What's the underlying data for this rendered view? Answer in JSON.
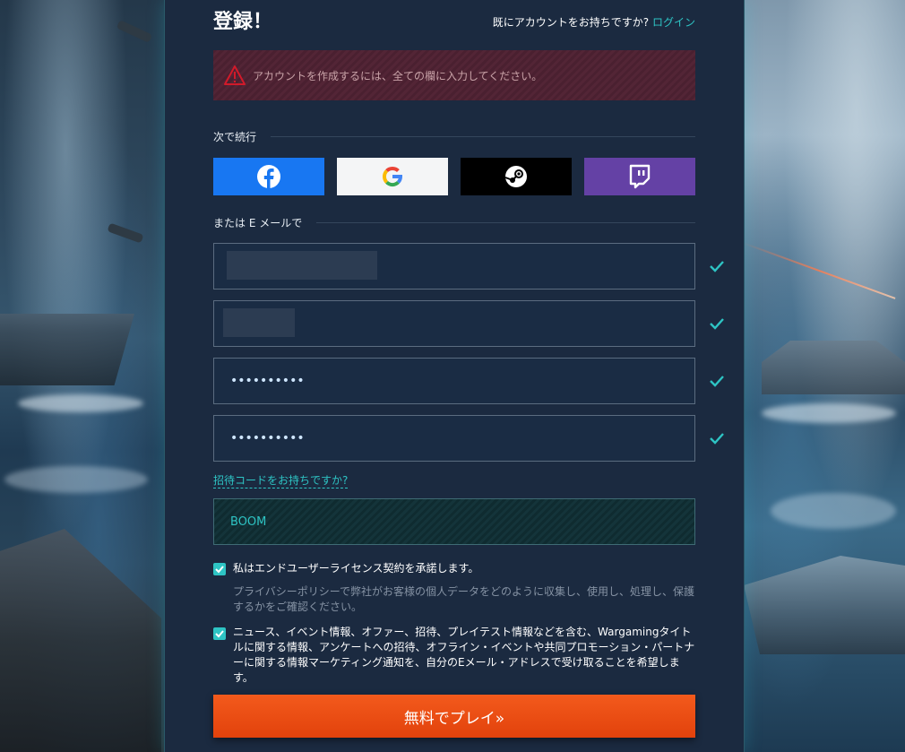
{
  "header": {
    "title": "登録！",
    "login_prompt": "既にアカウントをお持ちですか?",
    "login_link": "ログイン"
  },
  "error": {
    "icon": "warning-icon",
    "message": "アカウントを作成するには、全ての欄に入力してください。"
  },
  "social": {
    "section_label": "次で続行",
    "buttons": [
      {
        "name": "facebook",
        "icon": "facebook-icon",
        "color": "#1877f2"
      },
      {
        "name": "google",
        "icon": "google-icon",
        "color": "#f4f5f6"
      },
      {
        "name": "steam",
        "icon": "steam-icon",
        "color": "#000000"
      },
      {
        "name": "twitch",
        "icon": "twitch-icon",
        "color": "#6441a5"
      }
    ]
  },
  "email_section": {
    "label": "または E メールで",
    "fields": [
      {
        "name": "email",
        "value": "",
        "valid": true
      },
      {
        "name": "username",
        "value": "",
        "valid": true
      },
      {
        "name": "password",
        "value": "••••••••••",
        "valid": true
      },
      {
        "name": "password-confirm",
        "value": "••••••••••",
        "valid": true
      }
    ]
  },
  "invite": {
    "link_text": "招待コードをお持ちですか?",
    "code_value": "BOOM"
  },
  "consents": {
    "eula_checked": true,
    "eula_text": "私はエンドユーザーライセンス契約を承諾します。",
    "privacy_text": "プライバシーポリシーで弊社がお客様の個人データをどのように収集し、使用し、処理し、保護するかをご確認ください。",
    "marketing_checked": true,
    "marketing_text": "ニュース、イベント情報、オファー、招待、プレイテスト情報などを含む、Wargamingタイトルに関する情報、アンケートへの招待、オフライン・イベントや共同プロモーション・パートナーに関する情報マーケティング通知を、自分のEメール・アドレスで受け取ることを希望します。"
  },
  "submit": {
    "label": "無料でプレイ»"
  },
  "colors": {
    "accent": "#2ec4c4",
    "panel": "#1b2a40",
    "play_button": "#f04e16",
    "error_bg": "#4f2233"
  }
}
